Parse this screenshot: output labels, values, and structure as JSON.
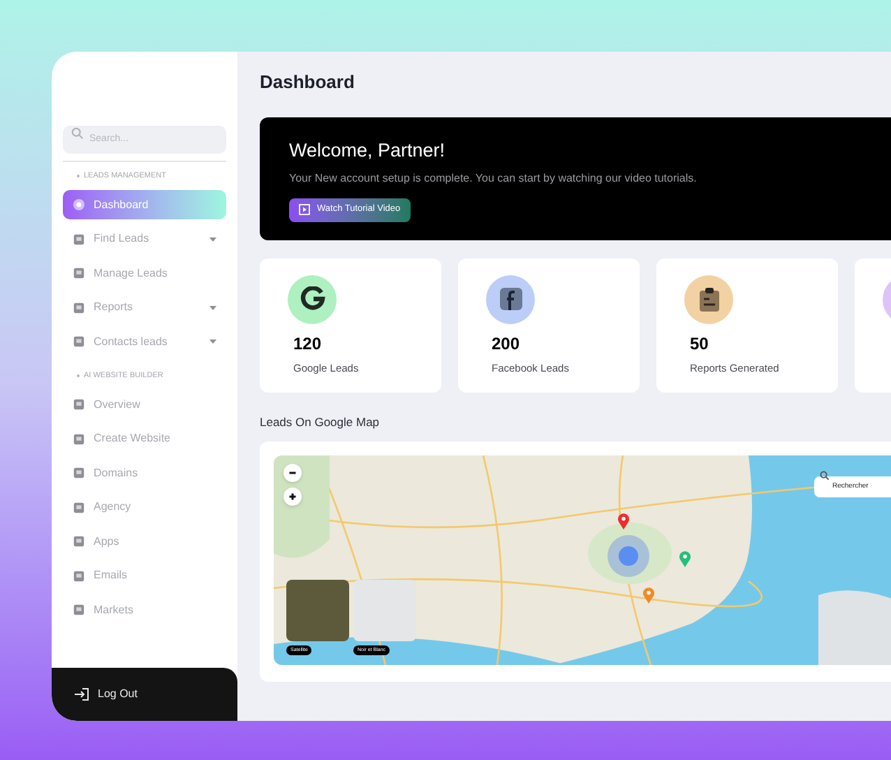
{
  "sidebar": {
    "search": {
      "placeholder": "Search..."
    },
    "sections": [
      {
        "title": "LEADS MANAGEMENT",
        "items": [
          {
            "label": "Dashboard",
            "selected": true,
            "dropdown": false
          },
          {
            "label": "Find Leads",
            "selected": false,
            "dropdown": true
          },
          {
            "label": "Manage Leads",
            "selected": false,
            "dropdown": false
          },
          {
            "label": "Reports",
            "selected": false,
            "dropdown": true
          },
          {
            "label": "Contacts leads",
            "selected": false,
            "dropdown": true
          }
        ]
      },
      {
        "title": "AI WEBSITE BUILDER",
        "items": [
          {
            "label": "Overview",
            "selected": false,
            "dropdown": false
          },
          {
            "label": "Create Website",
            "selected": false,
            "dropdown": false
          },
          {
            "label": "Domains",
            "selected": false,
            "dropdown": false
          },
          {
            "label": "Agency",
            "selected": false,
            "dropdown": false
          },
          {
            "label": "Apps",
            "selected": false,
            "dropdown": false
          },
          {
            "label": "Emails",
            "selected": false,
            "dropdown": false
          },
          {
            "label": "Markets",
            "selected": false,
            "dropdown": false
          }
        ]
      }
    ],
    "logout": "Log Out"
  },
  "page_title": "Dashboard",
  "welcome": {
    "title": "Welcome, Partner!",
    "text": "Your New account setup is complete. You can start by watching our video tutorials.",
    "button": "Watch Tutorial Video"
  },
  "stats": [
    {
      "kind": "google",
      "value": "120",
      "label": "Google Leads",
      "color": "#aef0c0"
    },
    {
      "kind": "facebook",
      "value": "200",
      "label": "Facebook Leads",
      "color": "#bccdf8"
    },
    {
      "kind": "reports",
      "value": "50",
      "label": "Reports Generated",
      "color": "#f2d2a2"
    },
    {
      "kind": "other",
      "color": "#dcc4f8"
    }
  ],
  "map": {
    "title": "Leads On Google Map",
    "search": {
      "placeholder": "Rechercher"
    },
    "layers": [
      {
        "label": "Satellite",
        "kind": "satellite"
      },
      {
        "label": "Noir et Blanc",
        "kind": "mono"
      }
    ],
    "markers": [
      {
        "color": "#ef2b2b"
      },
      {
        "color": "#22c07a"
      },
      {
        "color": "#f08a24"
      }
    ]
  }
}
